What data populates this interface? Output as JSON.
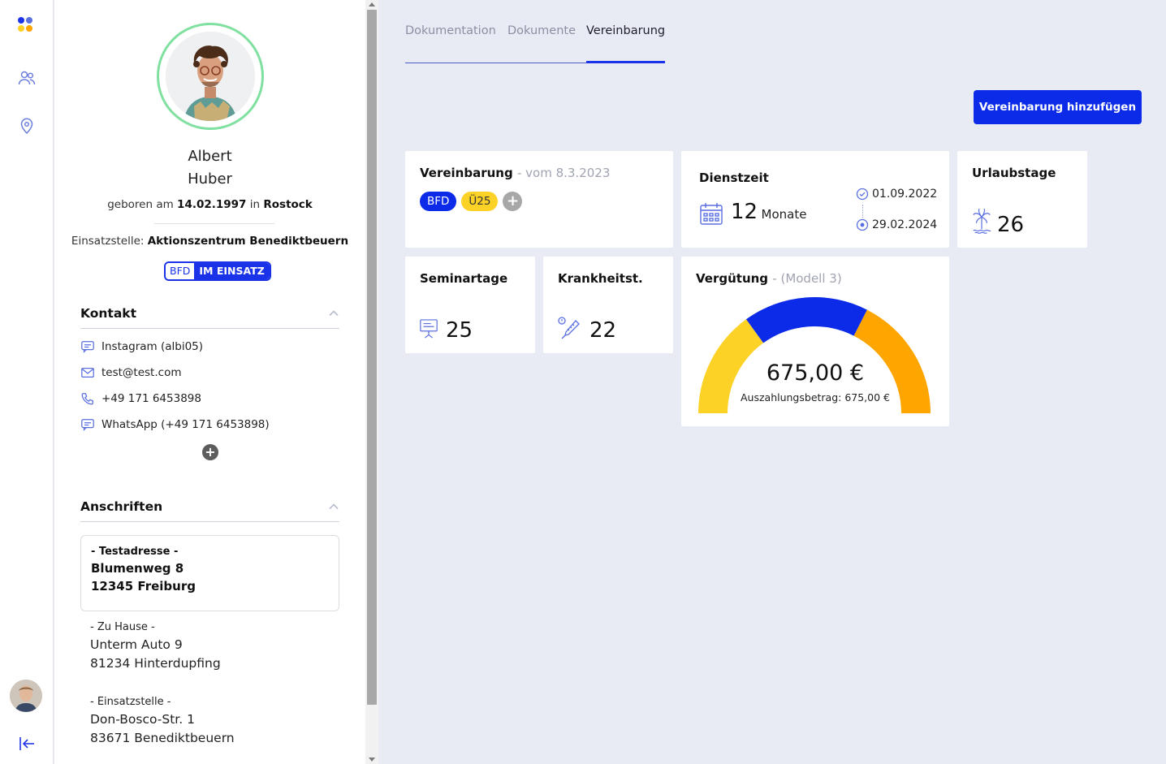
{
  "tabs": [
    {
      "label": "Dokumentation"
    },
    {
      "label": "Dokumente"
    },
    {
      "label": "Vereinbarung"
    }
  ],
  "profile": {
    "first_name": "Albert",
    "last_name": "Huber",
    "birth_prefix": "geboren am",
    "birth_date": "14.02.1997",
    "birth_in": "in",
    "birth_place": "Rostock",
    "einsatz_prefix": "Einsatzstelle:",
    "einsatz_place": "Aktionszentrum Benediktbeuern",
    "badge_left": "BFD",
    "badge_right": "IM EINSATZ"
  },
  "contact": {
    "title": "Kontakt",
    "items": [
      {
        "icon": "chat-icon",
        "text": "Instagram (albi05)"
      },
      {
        "icon": "mail-icon",
        "text": "test@test.com"
      },
      {
        "icon": "phone-icon",
        "text": "+49 171 6453898"
      },
      {
        "icon": "chat-icon",
        "text": "WhatsApp (+49 171 6453898)"
      }
    ],
    "add_label": "+"
  },
  "addresses": {
    "title": "Anschriften",
    "items": [
      {
        "label": "- Testadresse -",
        "street": "Blumenweg 8",
        "city": "12345 Freiburg"
      },
      {
        "label": "- Zu Hause -",
        "street": "Unterm Auto 9",
        "city": "81234 Hinterdupfing"
      },
      {
        "label": "- Einsatzstelle -",
        "street": "Don-Bosco-Str. 1",
        "city": "83671 Benediktbeuern"
      }
    ]
  },
  "actions": {
    "add_agreement": "Vereinbarung hinzufügen"
  },
  "cards": {
    "vereinbarung": {
      "title": "Vereinbarung",
      "sub": "- vom 8.3.2023",
      "tags": [
        "BFD",
        "Ü25"
      ],
      "add": "+"
    },
    "dienstzeit": {
      "title": "Dienstzeit",
      "value": "12",
      "unit": "Monate",
      "start": "01.09.2022",
      "end": "29.02.2024"
    },
    "urlaubstage": {
      "title": "Urlaubstage",
      "value": "26"
    },
    "seminartage": {
      "title": "Seminartage",
      "value": "25"
    },
    "krankheit": {
      "title": "Krankheitst.",
      "value": "22"
    },
    "verguetung": {
      "title": "Vergütung",
      "sub": "- (Modell 3)",
      "amount": "675,00 €",
      "payout": "Auszahlungsbetrag: 675,00 €",
      "segments": [
        {
          "share": 0.3,
          "color": "#fcd226"
        },
        {
          "share": 0.35,
          "color": "#0b2be8"
        },
        {
          "share": 0.35,
          "color": "#ffa500"
        }
      ]
    }
  },
  "colors": {
    "accent": "#0b2be8",
    "yellow": "#fcd226",
    "orange": "#ffa500",
    "ring": "#7fe0a0"
  }
}
